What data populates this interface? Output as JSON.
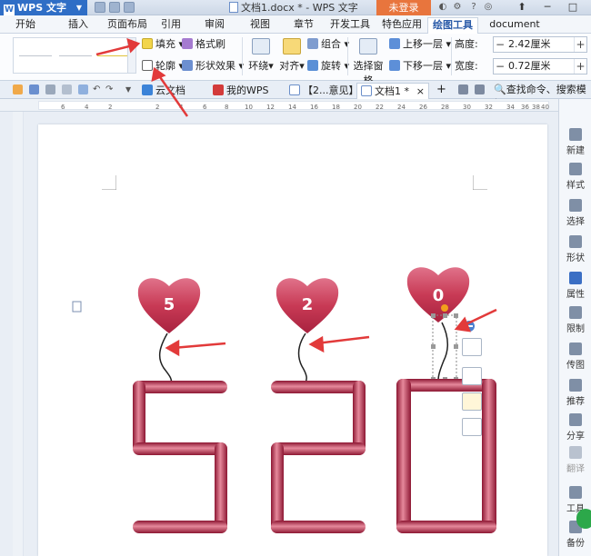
{
  "titlebar": {
    "app_name": "WPS 文字",
    "doc_title": "文档1.docx * - WPS 文字",
    "login_label": "未登录"
  },
  "menu": {
    "tabs": [
      "开始",
      "插入",
      "页面布局",
      "引用",
      "审阅",
      "视图",
      "章节",
      "开发工具",
      "特色应用",
      "绘图工具",
      "document tool"
    ],
    "active": "绘图工具"
  },
  "ribbon": {
    "fill_label": "填充",
    "format_painter_label": "格式刷",
    "outline_label": "轮廓",
    "shape_effect_label": "形状效果",
    "wrap_label": "环绕",
    "align_label": "对齐",
    "group_label": "组合",
    "rotate_label": "旋转",
    "selection_pane_label": "选择窗格",
    "bring_forward_label": "上移一层",
    "send_backward_label": "下移一层",
    "height_label": "高度:",
    "height_value": "2.42厘米",
    "width_label": "宽度:",
    "width_value": "0.72厘米",
    "minus": "−",
    "plus": "+"
  },
  "doc_tabs": {
    "cloud_label": "云文档",
    "tabs": [
      "我的WPS",
      "【2...意见】",
      "文档1 *"
    ],
    "close": "×",
    "add": "+",
    "search_label": "查找命令、搜索模板"
  },
  "ruler": {
    "ticks": [
      "6",
      "4",
      "2",
      "2",
      "4",
      "6",
      "8",
      "10",
      "12",
      "14",
      "16",
      "18",
      "20",
      "22",
      "24",
      "26",
      "28",
      "30",
      "32",
      "34",
      "36",
      "38",
      "40"
    ]
  },
  "artwork": {
    "balloons": [
      "5",
      "2",
      "0"
    ],
    "big_text": "520"
  },
  "side_panel": {
    "items": [
      "新建",
      "样式",
      "选择",
      "形状",
      "属性",
      "限制",
      "传图",
      "推荐",
      "分享",
      "翻译",
      "工具",
      "备份"
    ]
  },
  "colors": {
    "heart": "#c83a55",
    "digit": "#b02a47",
    "arrow": "#e23a3a",
    "accent": "#2f6ec6",
    "login": "#e8753d"
  }
}
